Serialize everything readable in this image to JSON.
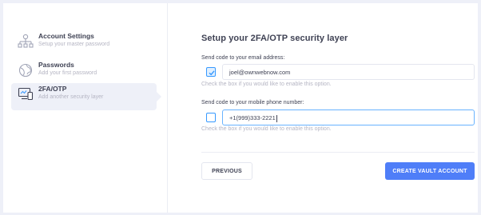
{
  "steps": [
    {
      "title": "Account Settings",
      "subtitle": "Setup your master password",
      "icon": "network-icon",
      "active": false
    },
    {
      "title": "Passwords",
      "subtitle": "Add your first password",
      "icon": "globe-icon",
      "active": false
    },
    {
      "title": "2FA/OTP",
      "subtitle": "Add another security layer",
      "icon": "devices-icon",
      "active": true
    }
  ],
  "main": {
    "heading": "Setup your 2FA/OTP security layer",
    "email": {
      "label": "Send code to your email address:",
      "checked": true,
      "value": "joel@ownwebnow.com",
      "hint": "Check the box if you would like to enable this option."
    },
    "phone": {
      "label": "Send code to your mobile phone number:",
      "checked": false,
      "value": "+1(999)333-2221",
      "hint": "Check the box if you would like to enable this option."
    }
  },
  "buttons": {
    "previous": "PREVIOUS",
    "create": "CREATE VAULT ACCOUNT"
  },
  "colors": {
    "primary": "#4f7ef8",
    "checkbox_border": "#3699ff",
    "muted_text": "#b5b5c3"
  }
}
